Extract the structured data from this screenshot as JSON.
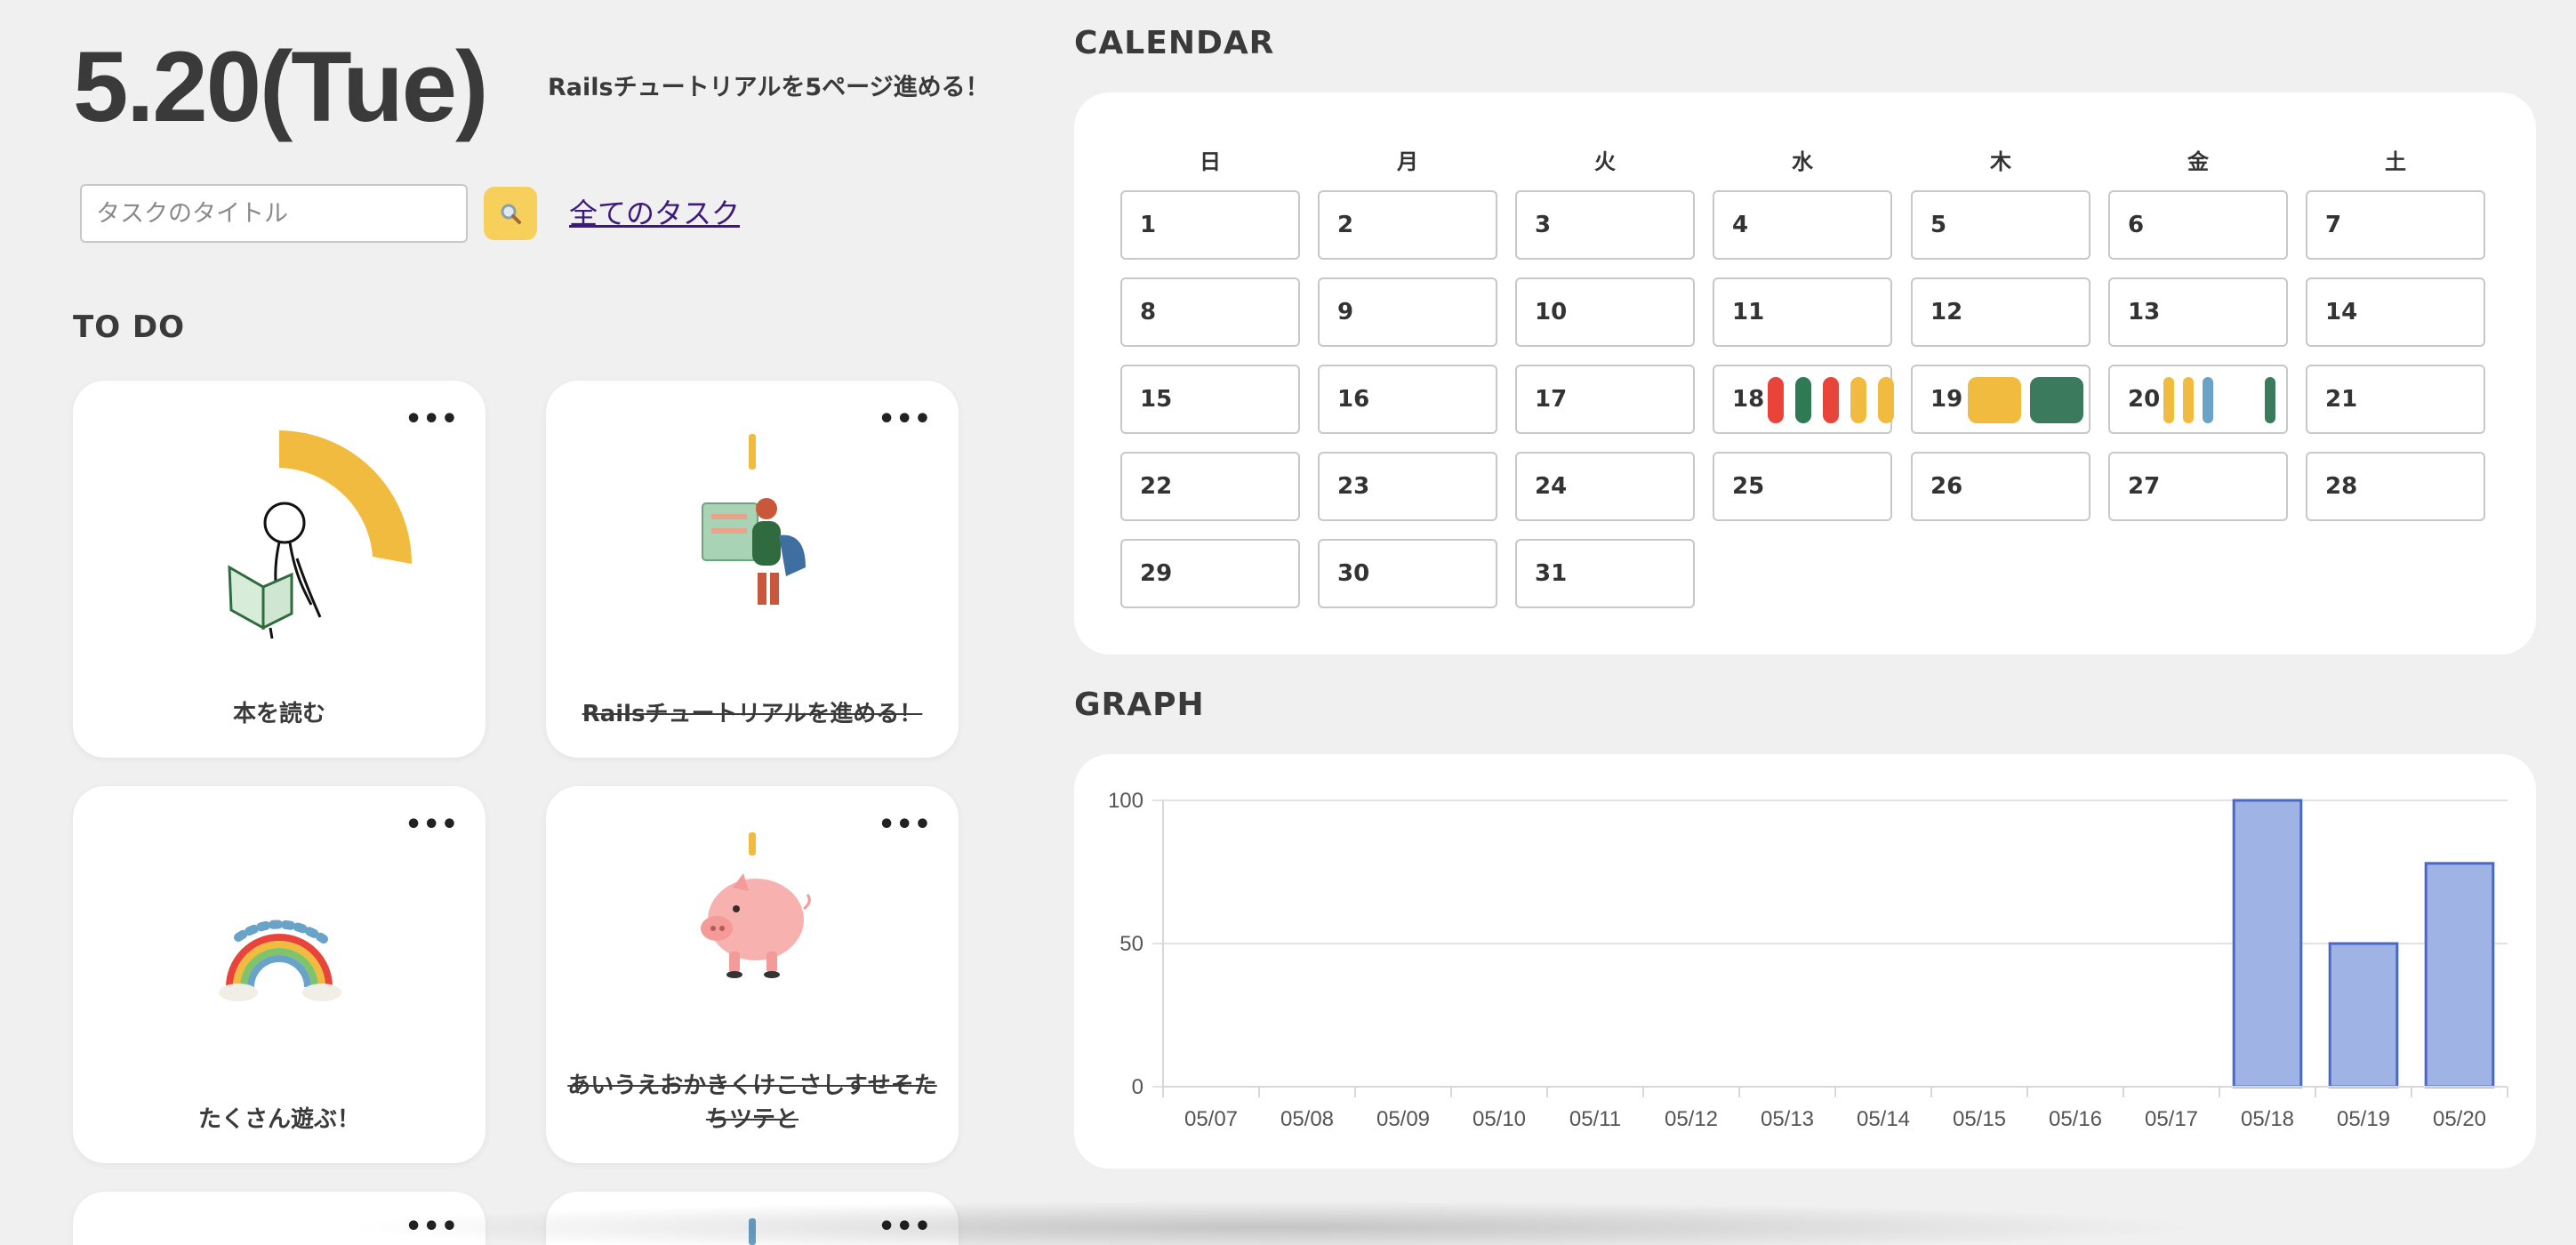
{
  "header": {
    "date": "5.20(Tue)",
    "note": "Railsチュートリアルを5ページ進める！"
  },
  "search": {
    "placeholder": "タスクのタイトル",
    "all_tasks_link": "全てのタスク"
  },
  "todo": {
    "title": "TO DO",
    "cards": [
      {
        "title": "本を読む",
        "done": false,
        "illustration": "reading-person-icon",
        "progress": 0.3
      },
      {
        "title": "Railsチュートリアルを進める！",
        "done": true,
        "illustration": "reading-person-chair-icon"
      },
      {
        "title": "たくさん遊ぶ！",
        "done": false,
        "illustration": "great-job-rainbow-icon"
      },
      {
        "title": "あいうえおかきくけこさしすせそたちツテと",
        "done": true,
        "illustration": "piggy-bank-icon"
      }
    ]
  },
  "calendar": {
    "title": "CALENDAR",
    "weekdays": [
      "日",
      "月",
      "火",
      "水",
      "木",
      "金",
      "土"
    ],
    "days": [
      "1",
      "2",
      "3",
      "4",
      "5",
      "6",
      "7",
      "8",
      "9",
      "10",
      "11",
      "12",
      "13",
      "14",
      "15",
      "16",
      "17",
      "18",
      "19",
      "20",
      "21",
      "22",
      "23",
      "24",
      "25",
      "26",
      "27",
      "28",
      "29",
      "30",
      "31"
    ],
    "markers": {
      "18": [
        "#e8443a",
        "#2f7a55",
        "#e8443a",
        "#f0bb3f",
        "#f0bb3f"
      ],
      "19": [
        "#f0bb3f",
        "#3b7a5c"
      ],
      "20": [
        "#f0bb3f",
        "#f0bb3f",
        "#6aa3c8",
        "#3b7a5c"
      ]
    }
  },
  "graph": {
    "title": "GRAPH"
  },
  "chart_data": {
    "type": "bar",
    "categories": [
      "05/07",
      "05/08",
      "05/09",
      "05/10",
      "05/11",
      "05/12",
      "05/13",
      "05/14",
      "05/15",
      "05/16",
      "05/17",
      "05/18",
      "05/19",
      "05/20"
    ],
    "values": [
      0,
      0,
      0,
      0,
      0,
      0,
      0,
      0,
      0,
      0,
      0,
      100,
      50,
      78
    ],
    "ylim": [
      0,
      100
    ],
    "yticks": [
      "0",
      "50",
      "100"
    ],
    "grid": true,
    "colors": {
      "fill": "#a0b3e5",
      "stroke": "#4a68c8"
    }
  }
}
